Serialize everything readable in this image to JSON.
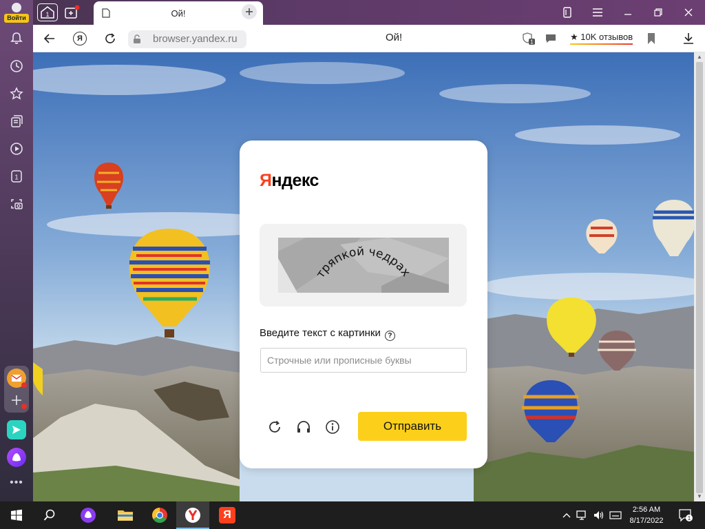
{
  "sidebar": {
    "login_label": "Войти",
    "items": [
      {
        "icon": "bell-icon"
      },
      {
        "icon": "history-icon"
      },
      {
        "icon": "bookmarks-star-icon"
      },
      {
        "icon": "collections-icon"
      },
      {
        "icon": "video-play-icon"
      },
      {
        "icon": "tab-count-icon",
        "label": "1"
      },
      {
        "icon": "screenshot-camera-icon"
      }
    ],
    "apps": [
      {
        "icon": "mail-app-icon"
      },
      {
        "icon": "add-app-icon"
      },
      {
        "icon": "messenger-app-icon"
      },
      {
        "icon": "alice-app-icon"
      }
    ],
    "more_label": "•••"
  },
  "tabs": {
    "home_badge": "1",
    "active_tab_title": "Ой!"
  },
  "addressbar": {
    "yandex_button": "Я",
    "url": "browser.yandex.ru",
    "page_title": "Ой!",
    "reviews_label": "★ 10K отзывов",
    "protect_badge": "1"
  },
  "captcha": {
    "logo_first": "Я",
    "logo_rest": "ндекс",
    "captcha_text": "тряпкой чедрах",
    "prompt": "Введите текст с картинки",
    "help_glyph": "?",
    "input_placeholder": "Строчные или прописные буквы",
    "input_value": "",
    "submit_label": "Отправить"
  },
  "taskbar": {
    "time": "2:56 AM",
    "date": "8/17/2022",
    "notification_count": "1",
    "yandex_app_label": "Я"
  },
  "colors": {
    "yandex_red": "#fc3f1d",
    "submit_yellow": "#fcd01a",
    "sidebar_top": "#6e4a78"
  }
}
